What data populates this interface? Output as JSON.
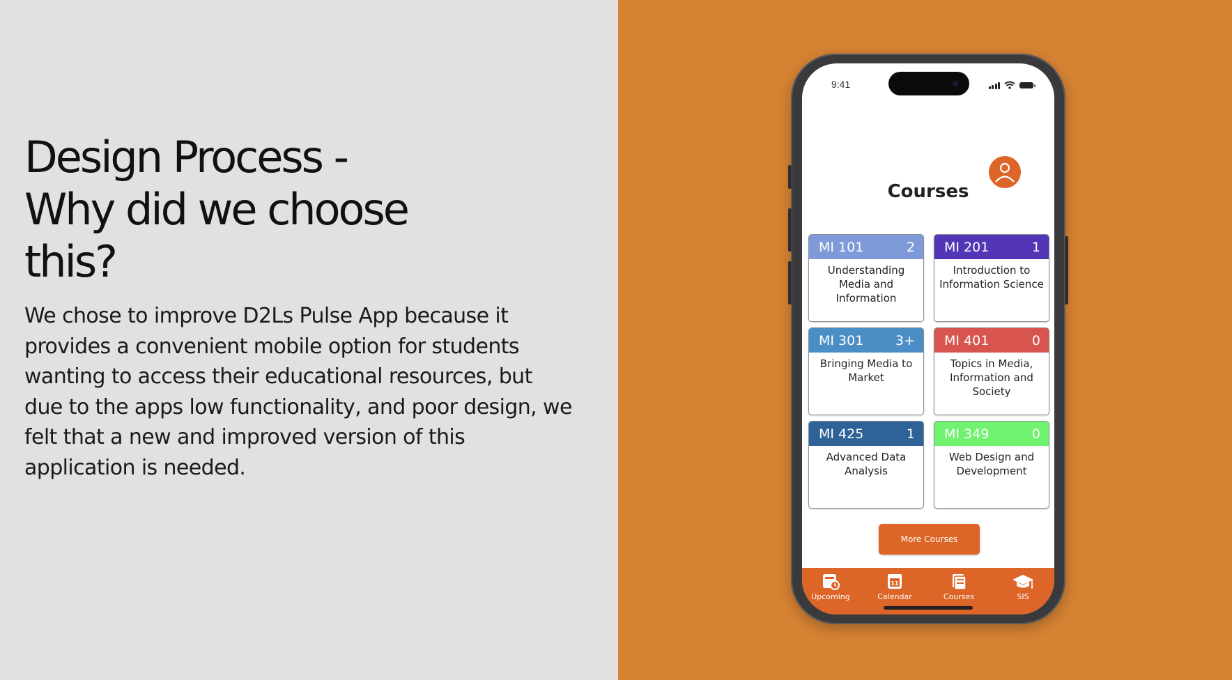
{
  "slide": {
    "heading_lines": [
      "Design Process -",
      "Why did we choose",
      "this?"
    ],
    "body": "We chose to improve D2Ls Pulse App because it provides a convenient mobile option for students wanting to access their educational resources, but due to the apps low functionality, and poor design, we felt that a new and improved version of this application is needed."
  },
  "colors": {
    "left_bg": "#e1e1e1",
    "right_bg": "#d58233",
    "accent": "#dc6527"
  },
  "phone": {
    "status_time": "9:41",
    "avatar_icon": "person-icon",
    "title": "Courses",
    "courses": [
      {
        "code": "MI 101",
        "count": "2",
        "name": "Understanding Media and Information",
        "color": "#7f9ad9"
      },
      {
        "code": "MI 201",
        "count": "1",
        "name": "Introduction to Information Science",
        "color": "#5336b5"
      },
      {
        "code": "MI 301",
        "count": "3+",
        "name": "Bringing Media to Market",
        "color": "#4b8ec6"
      },
      {
        "code": "MI 401",
        "count": "0",
        "name": "Topics in Media, Information and Society",
        "color": "#d7544f"
      },
      {
        "code": "MI 425",
        "count": "1",
        "name": "Advanced Data Analysis",
        "color": "#2f6297"
      },
      {
        "code": "MI 349",
        "count": "0",
        "name": "Web Design and Development",
        "color": "#6ef26f"
      }
    ],
    "more_button": "More Courses",
    "tabs": [
      {
        "label": "Upcoming",
        "icon": "upcoming-icon"
      },
      {
        "label": "Calendar",
        "icon": "calendar-icon",
        "badge": "11"
      },
      {
        "label": "Courses",
        "icon": "courses-icon"
      },
      {
        "label": "SIS",
        "icon": "graduation-cap-icon"
      }
    ]
  }
}
